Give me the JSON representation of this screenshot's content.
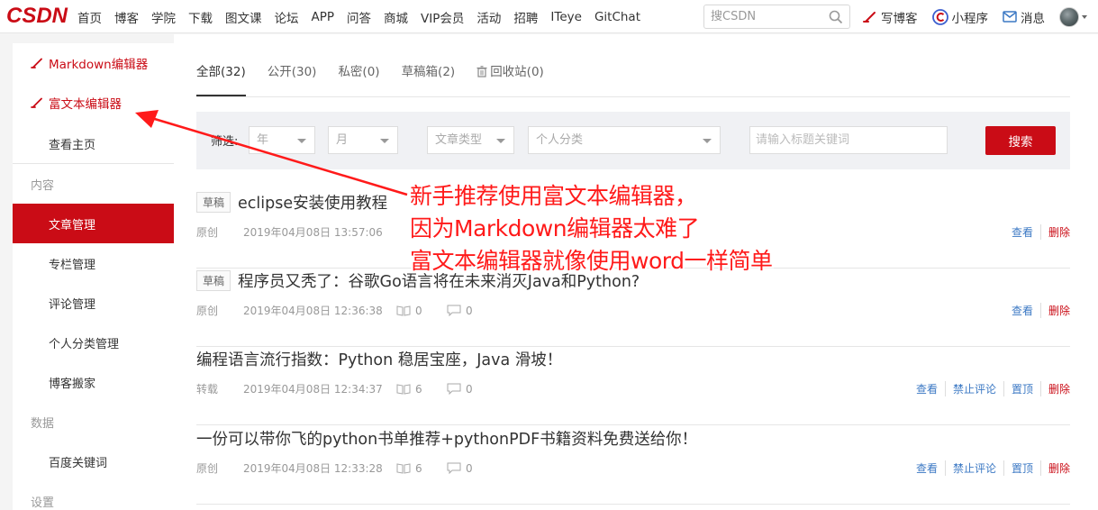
{
  "logo": "CSDN",
  "nav": [
    "首页",
    "博客",
    "学院",
    "下载",
    "图文课",
    "论坛",
    "APP",
    "问答",
    "商城",
    "VIP会员",
    "活动",
    "招聘",
    "ITeye",
    "GitChat"
  ],
  "search": {
    "placeholder": "搜CSDN"
  },
  "top_right": {
    "write": "写博客",
    "miniprogram": "小程序",
    "messages": "消息"
  },
  "sidebar": {
    "markdown_editor": "Markdown编辑器",
    "richtext_editor": "富文本编辑器",
    "home": "查看主页",
    "section_content": "内容",
    "items_content": [
      "文章管理",
      "专栏管理",
      "评论管理",
      "个人分类管理",
      "博客搬家"
    ],
    "section_data": "数据",
    "items_data": [
      "百度关键词"
    ],
    "section_settings": "设置"
  },
  "tabs": [
    "全部(32)",
    "公开(30)",
    "私密(0)",
    "草稿箱(2)",
    "回收站(0)"
  ],
  "filter": {
    "label": "筛选:",
    "year": "年",
    "month": "月",
    "article_type": "文章类型",
    "category": "个人分类",
    "keyword_placeholder": "请输入标题关键词",
    "search_button": "搜索"
  },
  "articles": [
    {
      "badge": "草稿",
      "title": "eclipse安装使用教程",
      "type": "原创",
      "date": "2019年04月08日 13:57:06",
      "views": "",
      "comments": "",
      "ops": [
        "查看",
        "删除"
      ]
    },
    {
      "badge": "草稿",
      "title": "程序员又秃了：谷歌Go语言将在未来消灭Java和Python?",
      "type": "原创",
      "date": "2019年04月08日 12:36:38",
      "views": "0",
      "comments": "0",
      "ops": [
        "查看",
        "删除"
      ]
    },
    {
      "badge": "",
      "title": "编程语言流行指数：Python 稳居宝座，Java 滑坡！",
      "type": "转载",
      "date": "2019年04月08日 12:34:37",
      "views": "6",
      "comments": "0",
      "ops": [
        "查看",
        "禁止评论",
        "置顶",
        "删除"
      ]
    },
    {
      "badge": "",
      "title": "一份可以带你飞的python书单推荐+pythonPDF书籍资料免费送给你！",
      "type": "原创",
      "date": "2019年04月08日 12:33:28",
      "views": "6",
      "comments": "0",
      "ops": [
        "查看",
        "禁止评论",
        "置顶",
        "删除"
      ]
    }
  ],
  "annotation": [
    "新手推荐使用富文本编辑器，",
    "因为Markdown编辑器太难了",
    "富文本编辑器就像使用word一样简单"
  ],
  "colors": {
    "brand": "#ca0c16",
    "link": "#3c79c4",
    "annotation": "#ff1a1a"
  },
  "icons": {
    "search": "search-icon",
    "pen": "pen-icon",
    "miniprogram": "miniprogram-icon",
    "mail": "mail-icon",
    "trash": "trash-icon",
    "book": "book-icon",
    "comment": "comment-icon"
  }
}
